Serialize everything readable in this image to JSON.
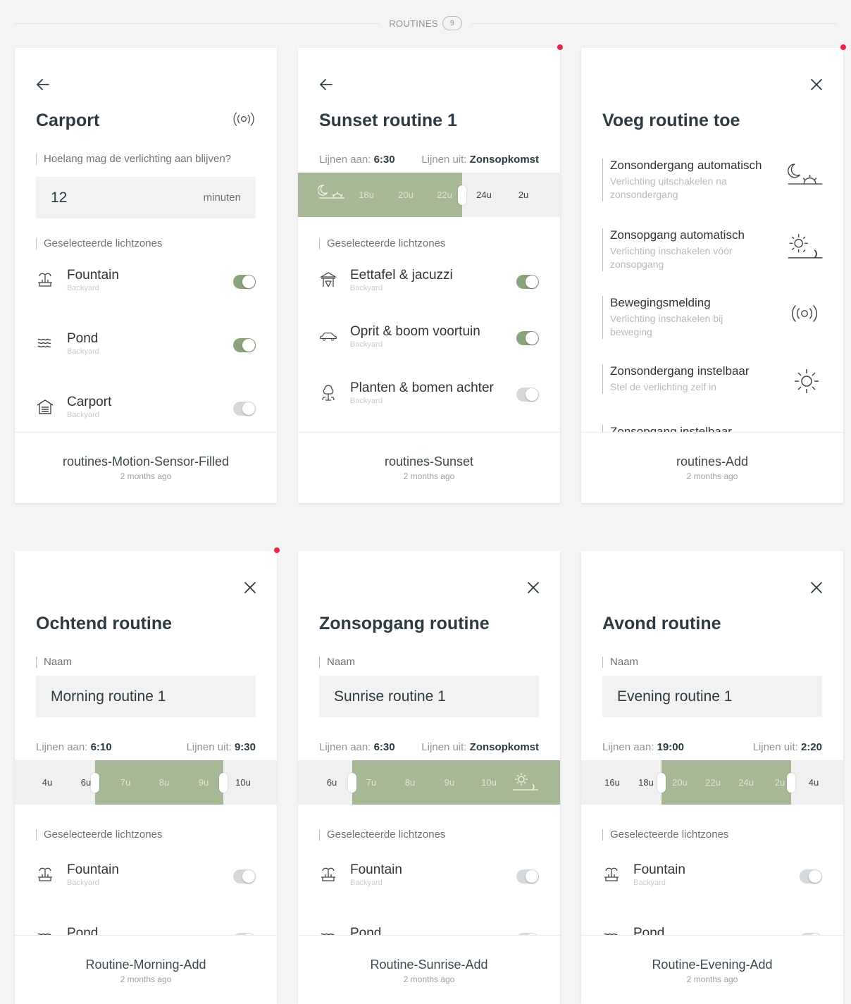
{
  "section": {
    "label": "ROUTINES",
    "count": "9"
  },
  "cards": [
    {
      "title": "Carport",
      "duration_label": "Hoelang mag de verlichting aan blijven?",
      "duration_value": "12",
      "duration_unit": "minuten",
      "zones_label": "Geselecteerde lichtzones",
      "zones": [
        {
          "name": "Fountain",
          "sub": "Backyard",
          "on": true
        },
        {
          "name": "Pond",
          "sub": "Backyard",
          "on": true
        },
        {
          "name": "Carport",
          "sub": "Backyard",
          "on": false
        }
      ],
      "footer_name": "routines-Motion-Sensor-Filled",
      "footer_date": "2 months ago"
    },
    {
      "title": "Sunset routine 1",
      "on_label": "Lijnen aan:",
      "on_value": "6:30",
      "off_label": "Lijnen uit:",
      "off_value": "Zonsopkomst",
      "ticks": [
        "18u",
        "20u",
        "22u",
        "24u",
        "2u"
      ],
      "zones_label": "Geselecteerde lichtzones",
      "zones": [
        {
          "name": "Eettafel & jacuzzi",
          "sub": "Backyard",
          "on": true
        },
        {
          "name": "Oprit & boom voortuin",
          "sub": "Backyard",
          "on": true
        },
        {
          "name": "Planten & bomen achter",
          "sub": "Backyard",
          "on": false
        }
      ],
      "footer_name": "routines-Sunset",
      "footer_date": "2 months ago"
    },
    {
      "title": "Voeg routine toe",
      "options": [
        {
          "title": "Zonsondergang automatisch",
          "desc": "Verlichting uitschakelen na zonsondergang"
        },
        {
          "title": "Zonsopgang automatisch",
          "desc": "Verlichting inschakelen vóór zonsopgang"
        },
        {
          "title": "Bewegingsmelding",
          "desc": "Verlichting inschakelen bij beweging"
        },
        {
          "title": "Zonsondergang instelbaar",
          "desc": "Stel de verlichting zelf in"
        },
        {
          "title": "Zonsopgang instelbaar",
          "desc": ""
        }
      ],
      "footer_name": "routines-Add",
      "footer_date": "2 months ago"
    },
    {
      "title": "Ochtend routine",
      "name_label": "Naam",
      "name_value": "Morning routine 1",
      "on_label": "Lijnen aan:",
      "on_value": "6:10",
      "off_label": "Lijnen uit:",
      "off_value": "9:30",
      "ticks": [
        "4u",
        "6u",
        "7u",
        "8u",
        "9u",
        "10u"
      ],
      "zones_label": "Geselecteerde lichtzones",
      "zones": [
        {
          "name": "Fountain",
          "sub": "Backyard",
          "on": false
        },
        {
          "name": "Pond",
          "sub": "",
          "on": false
        }
      ],
      "footer_name": "Routine-Morning-Add",
      "footer_date": "2 months ago"
    },
    {
      "title": "Zonsopgang routine",
      "name_label": "Naam",
      "name_value": "Sunrise routine 1",
      "on_label": "Lijnen aan:",
      "on_value": "6:30",
      "off_label": "Lijnen uit:",
      "off_value": "Zonsopkomst",
      "ticks": [
        "6u",
        "7u",
        "8u",
        "9u",
        "10u"
      ],
      "zones_label": "Geselecteerde lichtzones",
      "zones": [
        {
          "name": "Fountain",
          "sub": "Backyard",
          "on": false
        },
        {
          "name": "Pond",
          "sub": "",
          "on": false
        }
      ],
      "footer_name": "Routine-Sunrise-Add",
      "footer_date": "2 months ago"
    },
    {
      "title": "Avond routine",
      "name_label": "Naam",
      "name_value": "Evening routine 1",
      "on_label": "Lijnen aan:",
      "on_value": "19:00",
      "off_label": "Lijnen uit:",
      "off_value": "2:20",
      "ticks": [
        "16u",
        "18u",
        "20u",
        "22u",
        "24u",
        "2u",
        "4u"
      ],
      "zones_label": "Geselecteerde lichtzones",
      "zones": [
        {
          "name": "Fountain",
          "sub": "Backyard",
          "on": false
        },
        {
          "name": "Pond",
          "sub": "",
          "on": false
        }
      ],
      "footer_name": "Routine-Evening-Add",
      "footer_date": "2 months ago"
    }
  ],
  "colors": {
    "accent": "#a6b896",
    "toggle_on": "#8aa37a",
    "notification": "#e8264d"
  }
}
